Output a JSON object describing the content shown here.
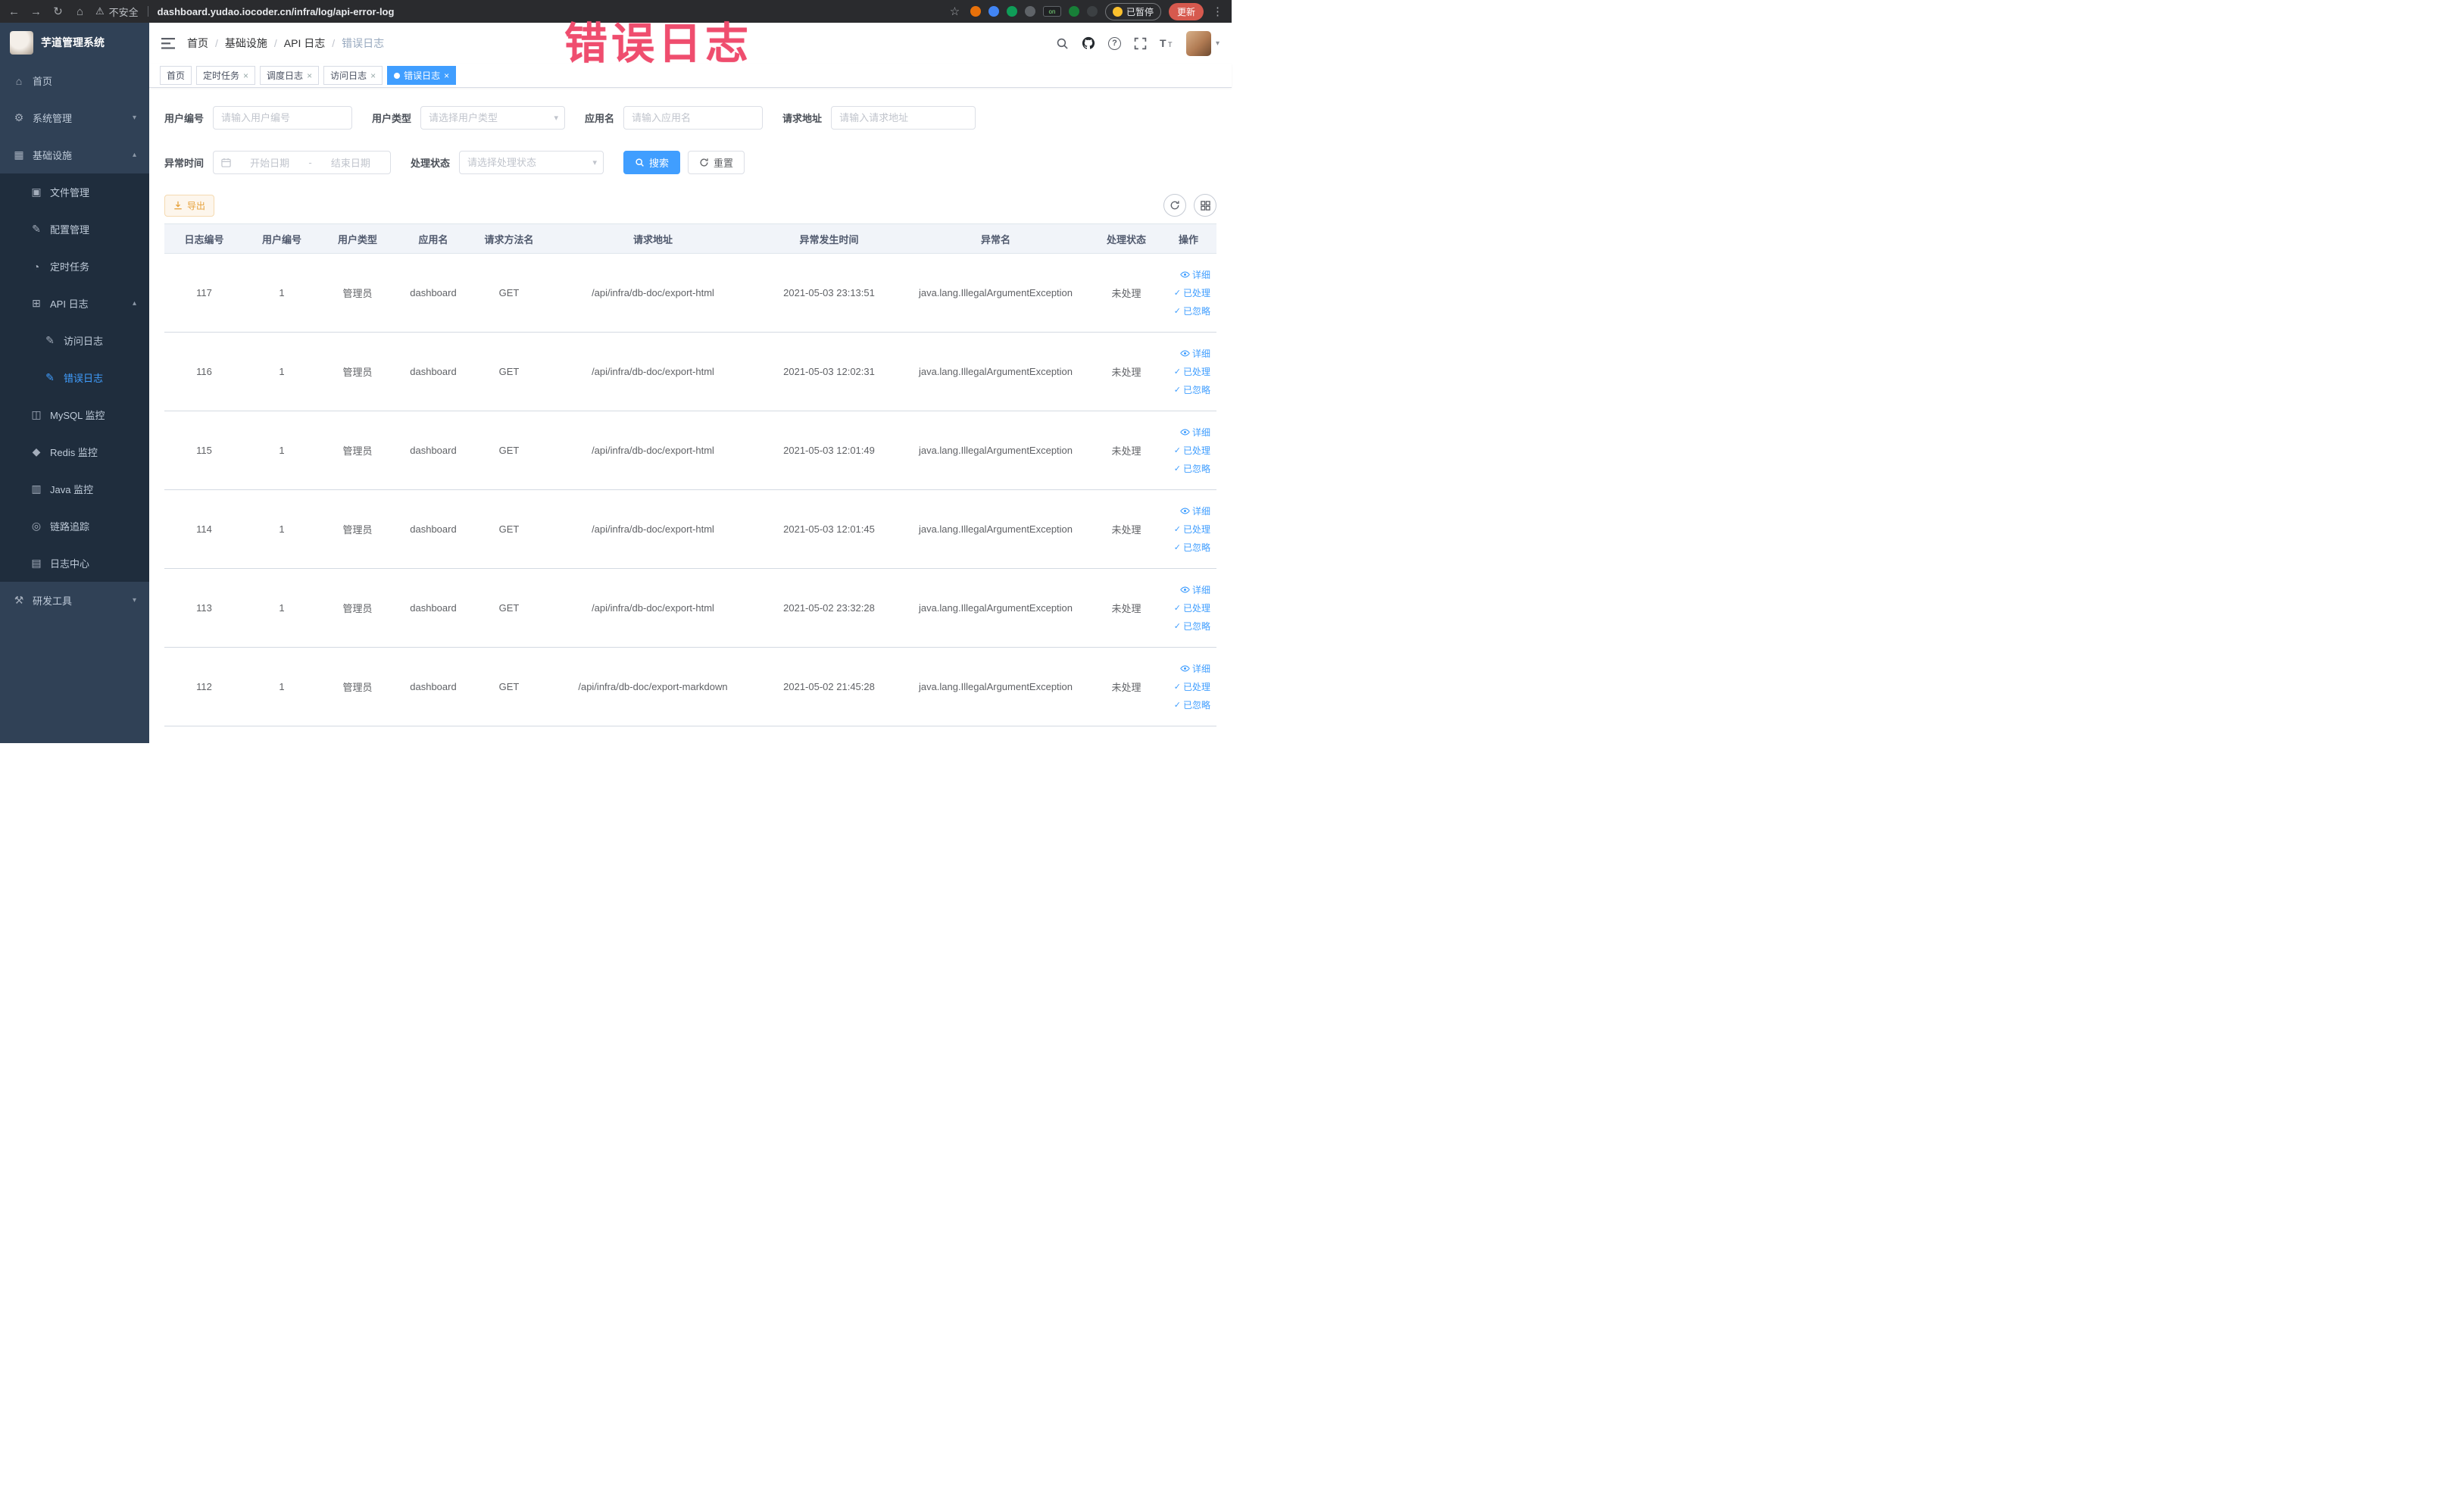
{
  "browser": {
    "security_label": "不安全",
    "url": "dashboard.yudao.iocoder.cn/infra/log/api-error-log",
    "paused_badge": "已暂停",
    "update_button": "更新"
  },
  "overlay": {
    "watermark": "错误日志"
  },
  "sidebar": {
    "logo_title": "芋道管理系统",
    "items": [
      {
        "label": "首页"
      },
      {
        "label": "系统管理"
      },
      {
        "label": "基础设施"
      },
      {
        "label": "文件管理"
      },
      {
        "label": "配置管理"
      },
      {
        "label": "定时任务"
      },
      {
        "label": "API 日志"
      },
      {
        "label": "访问日志"
      },
      {
        "label": "错误日志"
      },
      {
        "label": "MySQL 监控"
      },
      {
        "label": "Redis 监控"
      },
      {
        "label": "Java 监控"
      },
      {
        "label": "链路追踪"
      },
      {
        "label": "日志中心"
      },
      {
        "label": "研发工具"
      }
    ]
  },
  "header": {
    "breadcrumb": [
      "首页",
      "基础设施",
      "API 日志",
      "错误日志"
    ],
    "breadcrumb_separator": "/"
  },
  "tabs": [
    {
      "label": "首页"
    },
    {
      "label": "定时任务"
    },
    {
      "label": "调度日志"
    },
    {
      "label": "访问日志"
    },
    {
      "label": "错误日志"
    }
  ],
  "filters": {
    "user_id_label": "用户编号",
    "user_id_placeholder": "请输入用户编号",
    "user_type_label": "用户类型",
    "user_type_placeholder": "请选择用户类型",
    "app_name_label": "应用名",
    "app_name_placeholder": "请输入应用名",
    "request_url_label": "请求地址",
    "request_url_placeholder": "请输入请求地址",
    "exception_time_label": "异常时间",
    "date_start_placeholder": "开始日期",
    "date_separator": "-",
    "date_end_placeholder": "结束日期",
    "process_status_label": "处理状态",
    "process_status_placeholder": "请选择处理状态",
    "search_button": "搜索",
    "reset_button": "重置"
  },
  "toolbar": {
    "export_button": "导出"
  },
  "table": {
    "columns": [
      "日志编号",
      "用户编号",
      "用户类型",
      "应用名",
      "请求方法名",
      "请求地址",
      "异常发生时间",
      "异常名",
      "处理状态",
      "操作"
    ],
    "actions": [
      "详细",
      "已处理",
      "已忽略"
    ],
    "rows": [
      {
        "id": "117",
        "user_id": "1",
        "user_type": "管理员",
        "app_name": "dashboard",
        "method": "GET",
        "url": "/api/infra/db-doc/export-html",
        "time": "2021-05-03 23:13:51",
        "exception": "java.lang.IllegalArgumentException",
        "status": "未处理"
      },
      {
        "id": "116",
        "user_id": "1",
        "user_type": "管理员",
        "app_name": "dashboard",
        "method": "GET",
        "url": "/api/infra/db-doc/export-html",
        "time": "2021-05-03 12:02:31",
        "exception": "java.lang.IllegalArgumentException",
        "status": "未处理"
      },
      {
        "id": "115",
        "user_id": "1",
        "user_type": "管理员",
        "app_name": "dashboard",
        "method": "GET",
        "url": "/api/infra/db-doc/export-html",
        "time": "2021-05-03 12:01:49",
        "exception": "java.lang.IllegalArgumentException",
        "status": "未处理"
      },
      {
        "id": "114",
        "user_id": "1",
        "user_type": "管理员",
        "app_name": "dashboard",
        "method": "GET",
        "url": "/api/infra/db-doc/export-html",
        "time": "2021-05-03 12:01:45",
        "exception": "java.lang.IllegalArgumentException",
        "status": "未处理"
      },
      {
        "id": "113",
        "user_id": "1",
        "user_type": "管理员",
        "app_name": "dashboard",
        "method": "GET",
        "url": "/api/infra/db-doc/export-html",
        "time": "2021-05-02 23:32:28",
        "exception": "java.lang.IllegalArgumentException",
        "status": "未处理"
      },
      {
        "id": "112",
        "user_id": "1",
        "user_type": "管理员",
        "app_name": "dashboard",
        "method": "GET",
        "url": "/api/infra/db-doc/export-markdown",
        "time": "2021-05-02 21:45:28",
        "exception": "java.lang.IllegalArgumentException",
        "status": "未处理"
      }
    ]
  },
  "icons": {
    "home": "⌂",
    "gear": "⚙",
    "infra": "▦",
    "file": "▣",
    "config": "✎",
    "timer": "◔",
    "api_log": "⊞",
    "access_log": "✎",
    "error_log": "✎",
    "mysql": "◫",
    "redis": "◆",
    "java": "▥",
    "trace": "◎",
    "log_center": "▤",
    "devtools": "⚒",
    "chevron_down": "▾",
    "chevron_up": "▴",
    "caret_down": "▾",
    "back": "←",
    "forward": "→",
    "reload": "↻",
    "browser_home": "⌂",
    "warning": "⚠",
    "star": "☆",
    "kebab": "⋮",
    "check": "✓",
    "close": "×"
  }
}
